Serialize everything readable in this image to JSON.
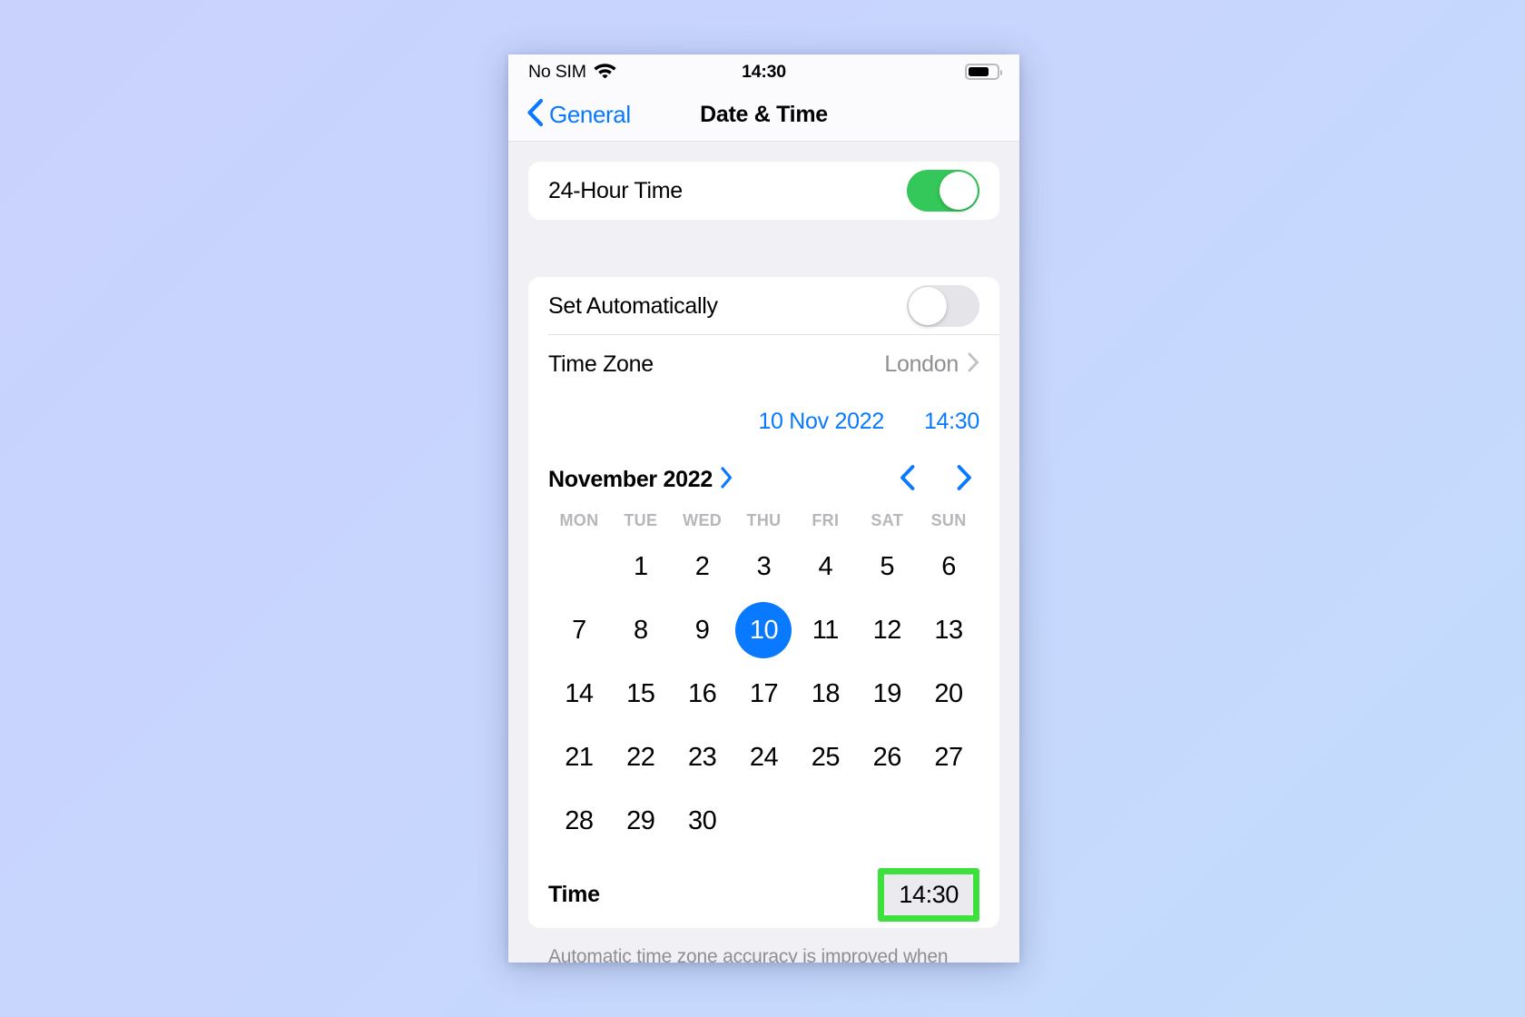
{
  "status_bar": {
    "carrier": "No SIM",
    "wifi_icon": "wifi-icon",
    "time": "14:30",
    "battery_icon": "battery-icon"
  },
  "nav": {
    "back_icon": "chevron-left-icon",
    "back_label": "General",
    "title": "Date & Time"
  },
  "section_hour": {
    "label": "24-Hour Time",
    "toggle_state": "on"
  },
  "section_auto": {
    "set_automatically_label": "Set Automatically",
    "set_automatically_state": "off",
    "time_zone_label": "Time Zone",
    "time_zone_value": "London",
    "time_zone_chevron_icon": "chevron-right-icon",
    "date_chip": "10 Nov 2022",
    "time_chip": "14:30"
  },
  "calendar": {
    "month_label": "November 2022",
    "month_expand_icon": "chevron-right-icon",
    "prev_icon": "chevron-left-icon",
    "next_icon": "chevron-right-icon",
    "weekdays": [
      "MON",
      "TUE",
      "WED",
      "THU",
      "FRI",
      "SAT",
      "SUN"
    ],
    "weeks": [
      [
        "",
        "1",
        "2",
        "3",
        "4",
        "5",
        "6"
      ],
      [
        "7",
        "8",
        "9",
        "10",
        "11",
        "12",
        "13"
      ],
      [
        "14",
        "15",
        "16",
        "17",
        "18",
        "19",
        "20"
      ],
      [
        "21",
        "22",
        "23",
        "24",
        "25",
        "26",
        "27"
      ],
      [
        "28",
        "29",
        "30",
        "",
        "",
        "",
        ""
      ]
    ],
    "selected_day": "10"
  },
  "time_row": {
    "label": "Time",
    "value": "14:30",
    "highlight_color": "#3ee03e"
  },
  "footer": {
    "note": "Automatic time zone accuracy is improved when"
  },
  "colors": {
    "accent_blue": "#097aff",
    "toggle_green": "#34c759",
    "highlight_green": "#3ee03e",
    "secondary_text": "#8e8e93",
    "page_background": "#c8d3fd"
  }
}
